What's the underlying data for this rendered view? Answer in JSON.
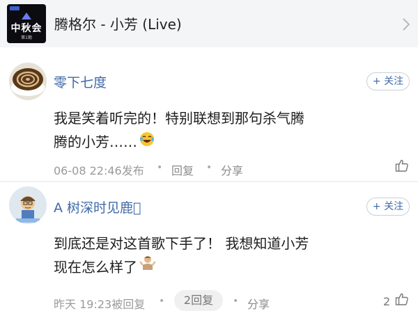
{
  "song": {
    "title": "腾格尔 - 小芳 (Live)",
    "album_cover": {
      "big_text": "中秋会",
      "small_text": "第1期"
    },
    "chevron_icon": "chevron-right-icon"
  },
  "comments": [
    {
      "username": "零下七度",
      "follow_label": "+ 关注",
      "text_line1": "我是笑着听完的！特别联想到那句杀气腾",
      "text_line2": "腾的小芳……",
      "emoji": "laughing-tears-emoji",
      "time": "06-08 22:46发布",
      "reply_label": "回复",
      "share_label": "分享",
      "like_count": ""
    },
    {
      "username": "A 树深时见鹿\u0000",
      "follow_label": "+ 关注",
      "text_line1": "到底还是对这首歌下手了！   我想知道小芳",
      "text_line2": "现在怎么样了",
      "emoji": "shrug-emoji",
      "time": "昨天 19:23被回复",
      "reply_pill": "2回复",
      "share_label": "分享",
      "like_count": "2"
    }
  ],
  "colors": {
    "username": "#3f6aa8",
    "meta": "#9a9a9a",
    "pill_bg": "#f0f0f0"
  }
}
